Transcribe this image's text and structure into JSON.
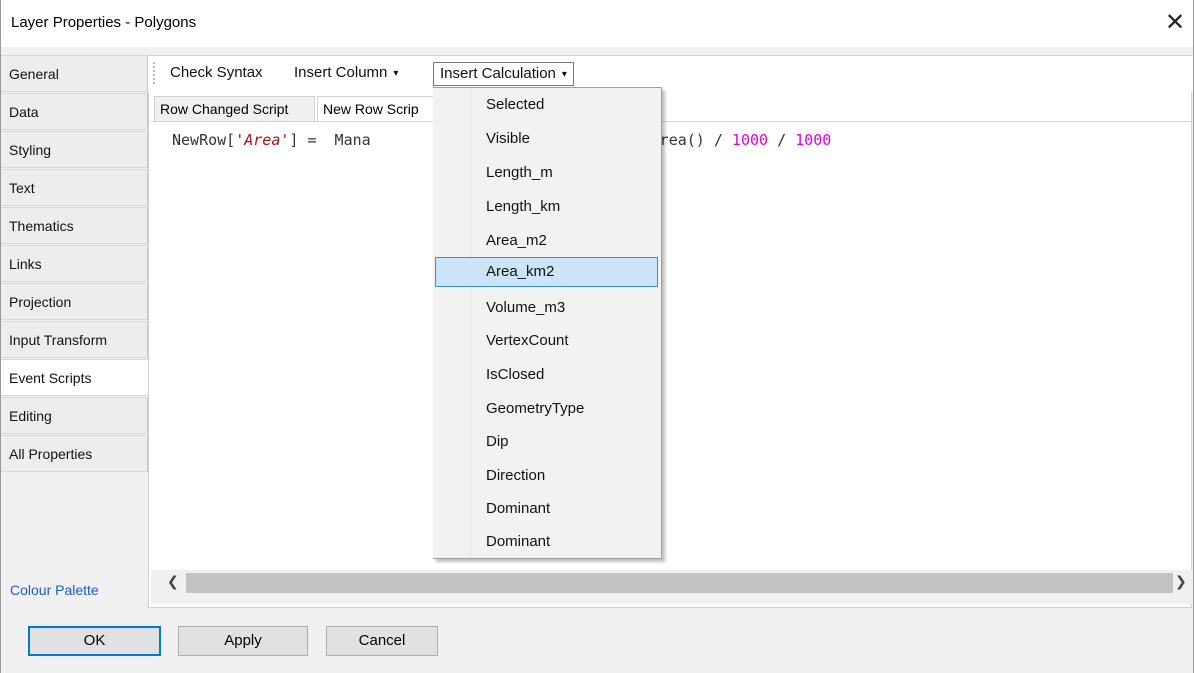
{
  "window": {
    "title": "Layer Properties - Polygons"
  },
  "sidebar": {
    "items": [
      {
        "label": "General"
      },
      {
        "label": "Data"
      },
      {
        "label": "Styling"
      },
      {
        "label": "Text"
      },
      {
        "label": "Thematics"
      },
      {
        "label": "Links"
      },
      {
        "label": "Projection"
      },
      {
        "label": "Input Transform"
      },
      {
        "label": "Event Scripts"
      },
      {
        "label": "Editing"
      },
      {
        "label": "All Properties"
      }
    ],
    "active": "Event Scripts",
    "colour_palette": "Colour Palette"
  },
  "toolbar": {
    "check_syntax": "Check Syntax",
    "insert_column": "Insert Column",
    "insert_calculation": "Insert Calculation",
    "caret": "▾"
  },
  "script_tabs": [
    {
      "label": "Row Changed Script"
    },
    {
      "label": "New Row Scrip"
    }
  ],
  "editor": {
    "code_prefix": "NewRow[",
    "code_string": "'Area'",
    "code_mid": "] =  Mana",
    "code_call": "        .ToCartesian(Geometry).Area() / ",
    "num1": "1000",
    "code_div": " / ",
    "num2": "1000"
  },
  "menu": {
    "items": [
      "Selected",
      "Visible",
      "Length_m",
      "Length_km",
      "Area_m2",
      "Area_km2",
      "Volume_m3",
      "VertexCount",
      "IsClosed",
      "GeometryType",
      "Dip",
      "Direction",
      "Dominant",
      "Dominant"
    ],
    "highlighted": "Area_km2"
  },
  "buttons": {
    "ok": "OK",
    "apply": "Apply",
    "cancel": "Cancel"
  },
  "colors": {
    "accent": "#0078d7",
    "menu_highlight": "#cce4f7",
    "string_literal": "#a31515",
    "number_literal": "#e000e0",
    "link": "#1f5cc0"
  }
}
